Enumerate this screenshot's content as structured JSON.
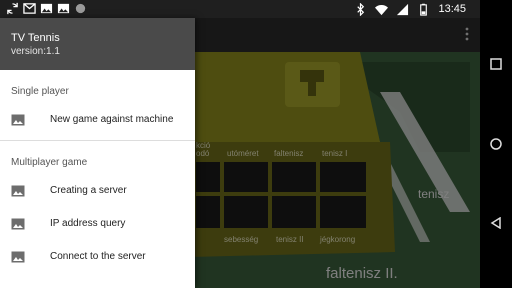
{
  "status_bar": {
    "time": "13:45",
    "left_icons": [
      "sync-icon",
      "gmail-icon",
      "image-icon",
      "image-icon",
      "circle-icon"
    ],
    "right_icons": [
      "bluetooth-icon",
      "wifi-icon",
      "signal-icon",
      "battery-icon"
    ]
  },
  "drawer": {
    "app_title": "TV Tennis",
    "version": "version:1.1",
    "sections": [
      {
        "title": "Single player",
        "items": [
          {
            "label": "New game against machine",
            "icon": "image-icon"
          }
        ]
      },
      {
        "title": "Multiplayer game",
        "items": [
          {
            "label": "Creating a server",
            "icon": "image-icon"
          },
          {
            "label": "IP address query",
            "icon": "image-icon"
          },
          {
            "label": "Connect to the server",
            "icon": "image-icon"
          }
        ]
      }
    ]
  },
  "game_image": {
    "console_labels": [
      "kció",
      "odó",
      "utóméret",
      "faltenisz",
      "tenisz I",
      "sebesség",
      "tenisz II",
      "jégkorong"
    ],
    "poster_labels": [
      "tenisz",
      "faltenisz II."
    ]
  },
  "nav_bar": {
    "icons": [
      "recents-icon",
      "home-icon",
      "back-icon"
    ]
  },
  "colors": {
    "status_bar": "#1f1f1f",
    "drawer_header": "#4a4a4a",
    "console_yellow": "#8f8d1e",
    "poster_green": "#3b5f3c"
  }
}
